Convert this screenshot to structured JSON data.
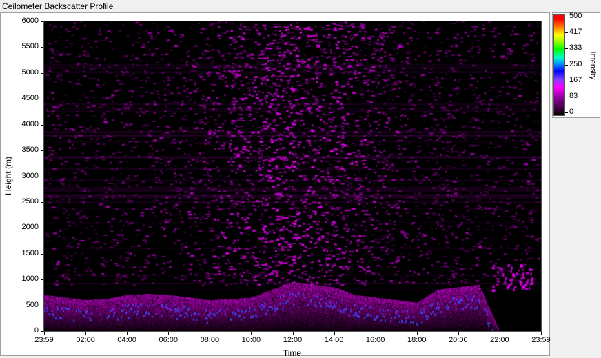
{
  "title": "Ceilometer Backscatter Profile",
  "chart_data": {
    "type": "heatmap",
    "title": "Ceilometer Backscatter Profile",
    "xlabel": "Time",
    "ylabel": "Height (m)",
    "x_ticks": [
      "23:59",
      "02:00",
      "04:00",
      "06:00",
      "08:00",
      "10:00",
      "12:00",
      "14:00",
      "16:00",
      "18:00",
      "20:00",
      "22:00",
      "23:59"
    ],
    "y_ticks": [
      "0",
      "500",
      "1000",
      "1500",
      "2000",
      "2500",
      "3000",
      "3500",
      "4000",
      "4500",
      "5000",
      "5500",
      "6000"
    ],
    "ylim": [
      0,
      6000
    ],
    "colorbar": {
      "label": "Intensity",
      "ticks": [
        "500",
        "417",
        "333",
        "250",
        "167",
        "83",
        "0"
      ],
      "range": [
        0,
        500
      ]
    },
    "layer_top_profile": {
      "time_hours": [
        0,
        1,
        2,
        3,
        4,
        5,
        6,
        7,
        8,
        9,
        10,
        11,
        12,
        13,
        14,
        15,
        16,
        17,
        18,
        19,
        20,
        21,
        22,
        23,
        24
      ],
      "height_m": [
        700,
        650,
        600,
        620,
        700,
        720,
        700,
        650,
        600,
        620,
        650,
        800,
        950,
        900,
        850,
        700,
        650,
        600,
        550,
        800,
        850,
        900,
        0,
        0,
        0
      ]
    },
    "grid": false
  }
}
